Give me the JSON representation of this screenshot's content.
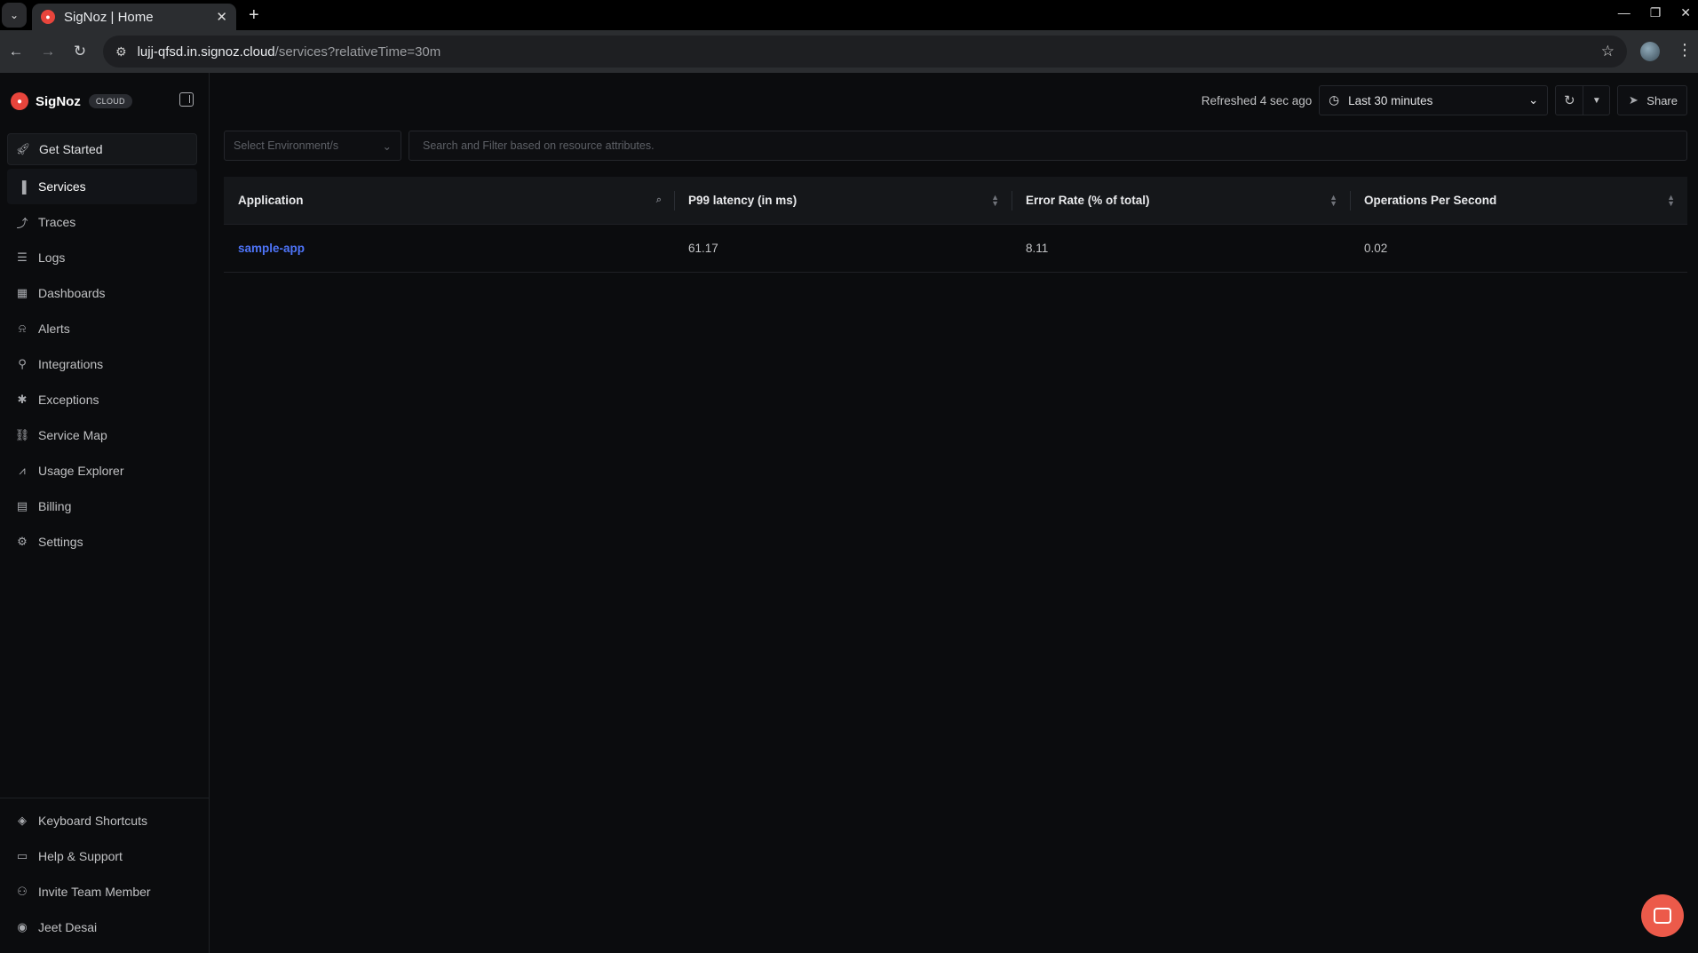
{
  "browser": {
    "tab_title": "SigNoz | Home",
    "url_host": "lujj-qfsd.in.signoz.cloud",
    "url_path": "/services?relativeTime=30m"
  },
  "sidebar": {
    "brand_name": "SigNoz",
    "brand_badge": "CLOUD",
    "get_started": "Get Started",
    "items": [
      {
        "label": "Services",
        "icon": "bar-chart-icon",
        "active": true
      },
      {
        "label": "Traces",
        "icon": "traces-icon"
      },
      {
        "label": "Logs",
        "icon": "logs-icon"
      },
      {
        "label": "Dashboards",
        "icon": "dashboards-icon"
      },
      {
        "label": "Alerts",
        "icon": "bell-icon"
      },
      {
        "label": "Integrations",
        "icon": "integrations-icon"
      },
      {
        "label": "Exceptions",
        "icon": "bug-icon"
      },
      {
        "label": "Service Map",
        "icon": "service-map-icon"
      },
      {
        "label": "Usage Explorer",
        "icon": "line-chart-icon"
      },
      {
        "label": "Billing",
        "icon": "receipt-icon"
      },
      {
        "label": "Settings",
        "icon": "gear-icon"
      }
    ],
    "bottom_items": [
      {
        "label": "Keyboard Shortcuts",
        "icon": "layers-icon"
      },
      {
        "label": "Help & Support",
        "icon": "message-icon"
      },
      {
        "label": "Invite Team Member",
        "icon": "user-plus-icon"
      },
      {
        "label": "Jeet Desai",
        "icon": "user-circle-icon"
      }
    ]
  },
  "toolbar": {
    "refreshed": "Refreshed 4 sec ago",
    "time_range": "Last 30 minutes",
    "share": "Share"
  },
  "filters": {
    "environment_placeholder": "Select Environment/s",
    "search_placeholder": "Search and Filter based on resource attributes."
  },
  "table": {
    "columns": [
      "Application",
      "P99 latency (in ms)",
      "Error Rate (% of total)",
      "Operations Per Second"
    ],
    "rows": [
      {
        "application": "sample-app",
        "p99": "61.17",
        "error_rate": "8.11",
        "ops": "0.02"
      }
    ]
  },
  "colors": {
    "accent_link": "#4e74f8",
    "brand": "#e8453c",
    "chat_button": "#ec5a4a"
  }
}
